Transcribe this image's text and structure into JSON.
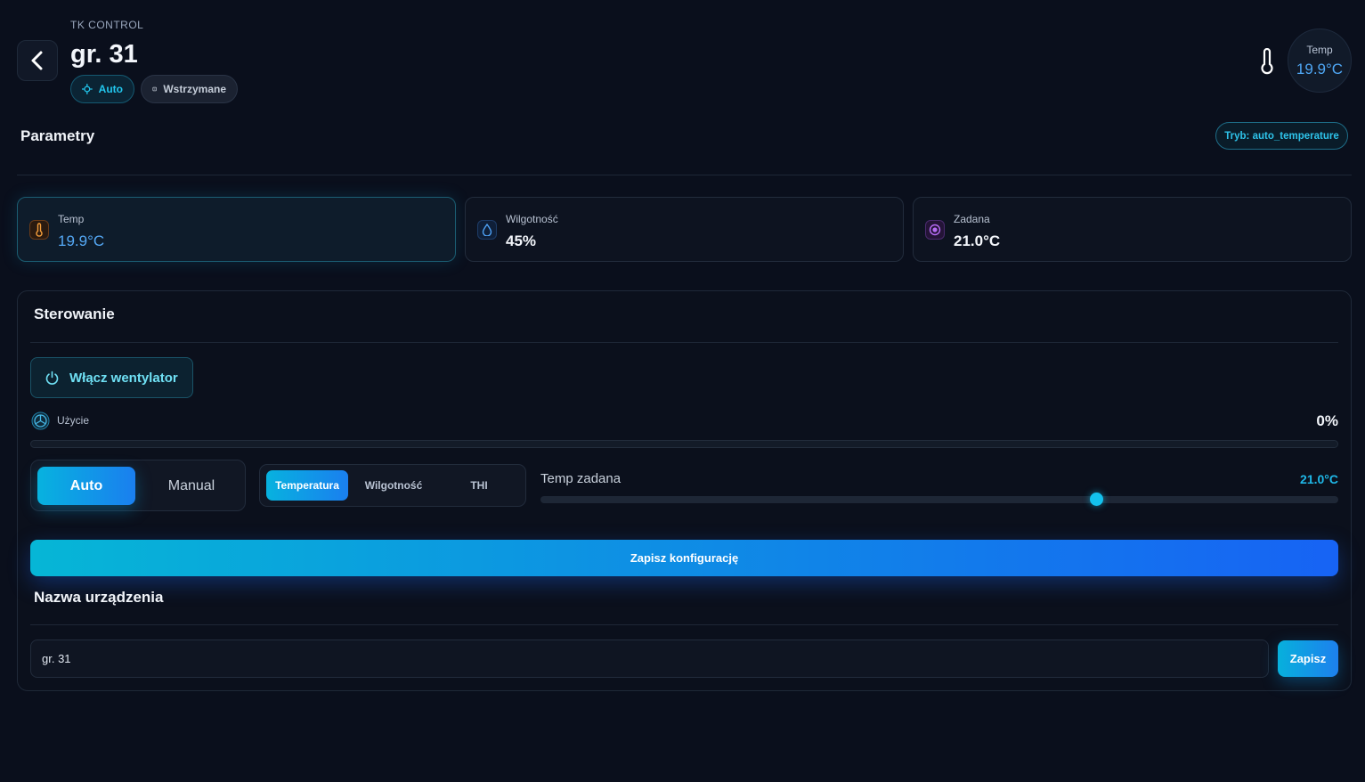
{
  "header": {
    "brand": "TK CONTROL",
    "title": "gr. 31",
    "chips": {
      "auto": "Auto",
      "paused": "Wstrzymane"
    },
    "temp_widget": {
      "label": "Temp",
      "value": "19.9°C"
    }
  },
  "parameters": {
    "title": "Parametry",
    "mode_badge": "Tryb: auto_temperature",
    "cards": [
      {
        "label": "Temp",
        "value": "19.9°C",
        "icon": "thermometer-icon"
      },
      {
        "label": "Wilgotność",
        "value": "45%",
        "icon": "droplet-icon"
      },
      {
        "label": "Zadana",
        "value": "21.0°C",
        "icon": "target-icon"
      }
    ]
  },
  "control": {
    "title": "Sterowanie",
    "fan_button": "Włącz wentylator",
    "usage": {
      "label": "Użycie",
      "value": "0%",
      "fraction": 0
    },
    "modes": {
      "auto": "Auto",
      "manual": "Manual",
      "selected": "Auto"
    },
    "sensors": {
      "temperature": "Temperatura",
      "humidity": "Wilgotność",
      "thi": "THI",
      "selected": "Temperatura"
    },
    "setpoint": {
      "label": "Temp zadana",
      "value": "21.0°C",
      "slider_fraction": 0.696
    },
    "save_config": "Zapisz konfigurację"
  },
  "device_name": {
    "title": "Nazwa urządzenia",
    "value": "gr. 31",
    "save": "Zapisz"
  },
  "colors": {
    "background": "#0a0f1c",
    "accent_cyan": "#06b6d4",
    "accent_blue": "#1763f4",
    "temp_blue": "#55a9f6"
  }
}
